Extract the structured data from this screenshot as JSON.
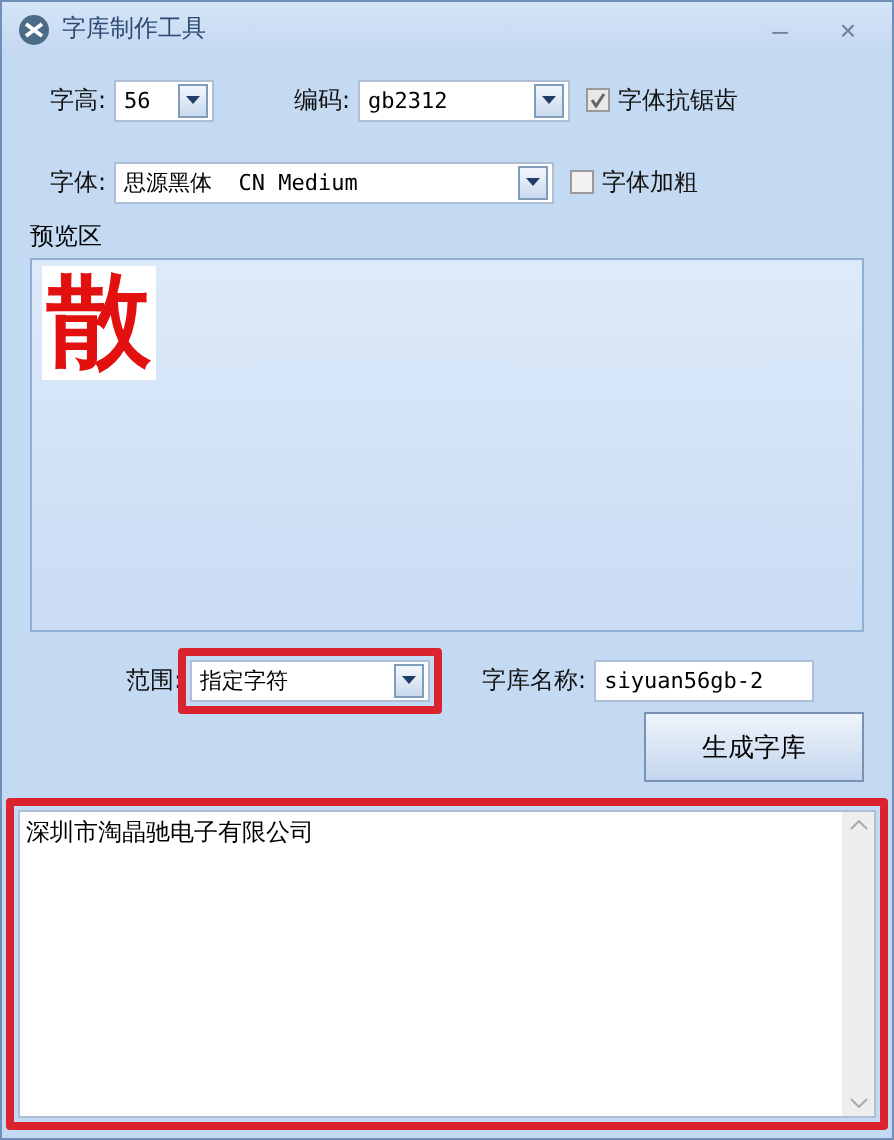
{
  "window": {
    "title": "字库制作工具",
    "controls": [
      "–",
      "×"
    ]
  },
  "height": {
    "label": "字高:",
    "value": "56"
  },
  "encoding": {
    "label": "编码:",
    "value": "gb2312"
  },
  "antialias": {
    "label": "字体抗锯齿",
    "checked": true
  },
  "font": {
    "label": "字体:",
    "value": "思源黑体  CN Medium"
  },
  "bold": {
    "label": "字体加粗",
    "checked": false
  },
  "preview": {
    "label": "预览区",
    "glyph": "散"
  },
  "range": {
    "label": "范围:",
    "value": "指定字符",
    "highlighted": true
  },
  "library_name": {
    "label": "字库名称:",
    "value": "siyuan56gb-2"
  },
  "generate_button": "生成字库",
  "characters": {
    "value": "深圳市淘晶驰电子有限公司",
    "highlighted": true
  }
}
